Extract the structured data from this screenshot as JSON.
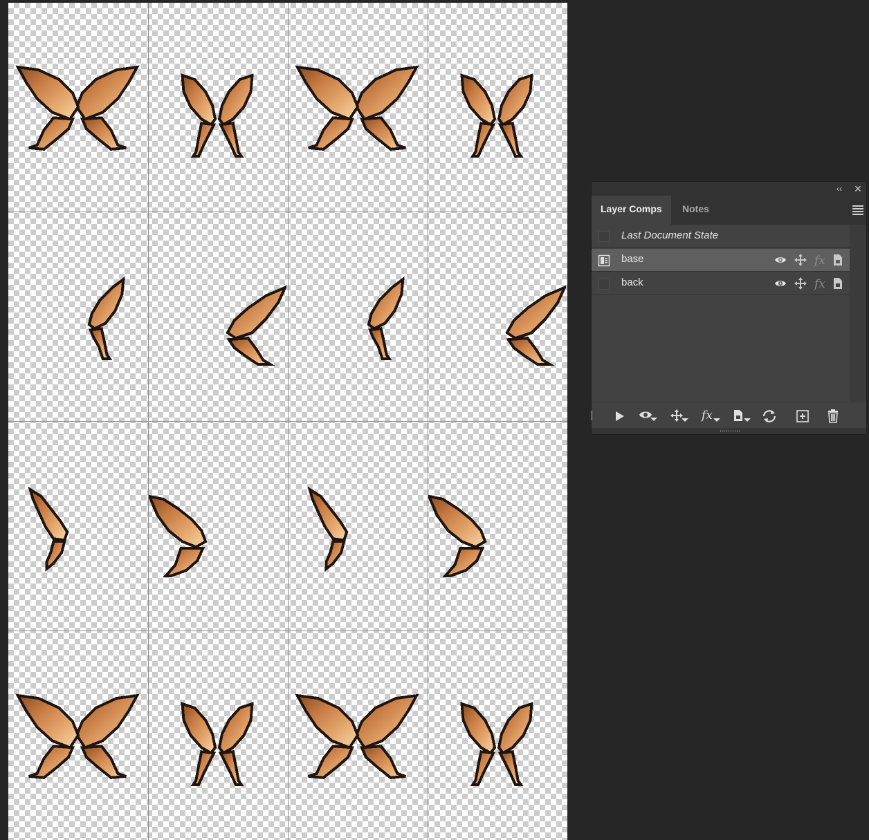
{
  "canvas": {
    "rows": [
      [
        "wing-open",
        "wing-narrow",
        "wing-open",
        "wing-narrow"
      ],
      [
        "wing-side-small",
        "wing-side-large",
        "wing-side-small",
        "wing-side-large"
      ],
      [
        "wing-back-small",
        "wing-back-large",
        "wing-back-small",
        "wing-back-large"
      ],
      [
        "wing-open",
        "wing-narrow",
        "wing-open",
        "wing-narrow"
      ]
    ],
    "colors": {
      "outline": "#1f1410",
      "dark": "#8a4b20",
      "mid": "#c87d45",
      "light": "#e6aa70",
      "highlight": "#f7d9ab"
    }
  },
  "panel": {
    "tabs": [
      {
        "label": "Layer Comps",
        "active": true
      },
      {
        "label": "Notes",
        "active": false
      }
    ],
    "comps": [
      {
        "name": "Last Document State",
        "selected": false,
        "applied": false
      },
      {
        "name": "base",
        "selected": true,
        "applied": true
      },
      {
        "name": "back",
        "selected": false,
        "applied": false
      }
    ],
    "bottom_icons": [
      "play-icon",
      "visibility-apply-icon",
      "position-apply-icon",
      "fx-apply-icon",
      "appearance-apply-icon",
      "update-icon",
      "new-comp-icon",
      "trash-icon"
    ]
  }
}
